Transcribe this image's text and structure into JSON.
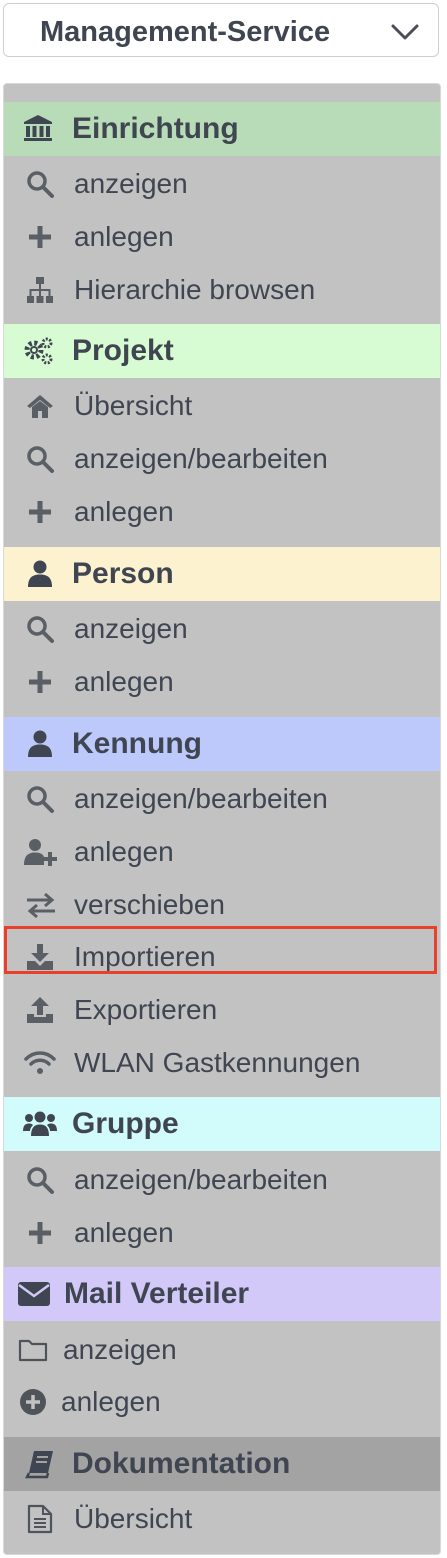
{
  "dropdown": {
    "label": "Management-Service"
  },
  "sections": [
    {
      "title": "Einrichtung",
      "icon": "institution-icon",
      "color": "#b9dcb8",
      "items": [
        {
          "label": "anzeigen",
          "icon": "search-icon"
        },
        {
          "label": "anlegen",
          "icon": "plus-icon"
        },
        {
          "label": "Hierarchie browsen",
          "icon": "sitemap-icon"
        }
      ]
    },
    {
      "title": "Projekt",
      "icon": "gears-icon",
      "color": "#d7fcd3",
      "items": [
        {
          "label": "Übersicht",
          "icon": "home-icon"
        },
        {
          "label": "anzeigen/bearbeiten",
          "icon": "search-icon"
        },
        {
          "label": "anlegen",
          "icon": "plus-icon"
        }
      ]
    },
    {
      "title": "Person",
      "icon": "user-icon",
      "color": "#fcf2d0",
      "items": [
        {
          "label": "anzeigen",
          "icon": "search-icon"
        },
        {
          "label": "anlegen",
          "icon": "plus-icon"
        }
      ]
    },
    {
      "title": "Kennung",
      "icon": "user-icon",
      "color": "#bec9fb",
      "items": [
        {
          "label": "anzeigen/bearbeiten",
          "icon": "search-icon"
        },
        {
          "label": "anlegen",
          "icon": "user-plus-icon"
        },
        {
          "label": "verschieben",
          "icon": "exchange-icon"
        },
        {
          "label": "Importieren",
          "icon": "download-icon"
        },
        {
          "label": "Exportieren",
          "icon": "upload-icon"
        },
        {
          "label": "WLAN Gastkennungen",
          "icon": "wifi-icon"
        }
      ]
    },
    {
      "title": "Gruppe",
      "icon": "users-icon",
      "color": "#d2fbfb",
      "items": [
        {
          "label": "anzeigen/bearbeiten",
          "icon": "search-icon"
        },
        {
          "label": "anlegen",
          "icon": "plus-icon"
        }
      ]
    },
    {
      "title": "Mail Verteiler",
      "icon": "envelope-icon",
      "color": "#d2c9f9",
      "items": [
        {
          "label": "anzeigen",
          "icon": "folder-icon"
        },
        {
          "label": "anlegen",
          "icon": "plus-circle-icon"
        }
      ]
    },
    {
      "title": "Dokumentation",
      "icon": "book-icon",
      "color": "#a3a3a3",
      "items": [
        {
          "label": "Übersicht",
          "icon": "file-text-icon"
        }
      ]
    }
  ]
}
